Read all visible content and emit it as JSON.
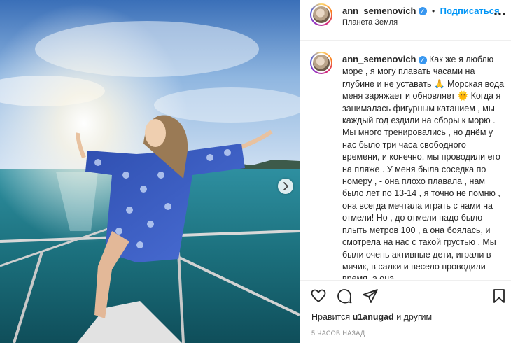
{
  "post": {
    "username": "ann_semenovich",
    "verified_mark": "✓",
    "separator": "•",
    "follow_label": "Подписаться",
    "location": "Планета Земля",
    "more_icon": "more-horizontal-icon",
    "caption": "Как же я люблю море , я могу плавать часами на глубине и не уставать 🙏 Морская вода меня заряжает и обновляет 🌞 Когда я занималась фигурным катанием , мы каждый год ездили на сборы к морю . Мы много тренировались , но днём у нас было три часа свободного времени, и конечно, мы проводили его на пляже . У меня была соседка по номеру , - она плохо плавала , нам было лет по 13-14 , я точно не помню , она всегда мечтала играть с нами на отмели! Но , до отмели надо было плыть метров 100 , а она боялась, и смотрела на нас с такой грустью . Мы были очень активные дети, играли в мячик, в салки и весело проводили время, а она",
    "likes_prefix": "Нравится",
    "likes_user": "u1anugad",
    "likes_suffix": "и другим",
    "timestamp": "5 ЧАСОВ НАЗАД"
  },
  "colors": {
    "accent": "#0095f6",
    "verified": "#3897f0",
    "text": "#262626",
    "muted": "#8e8e8e"
  }
}
